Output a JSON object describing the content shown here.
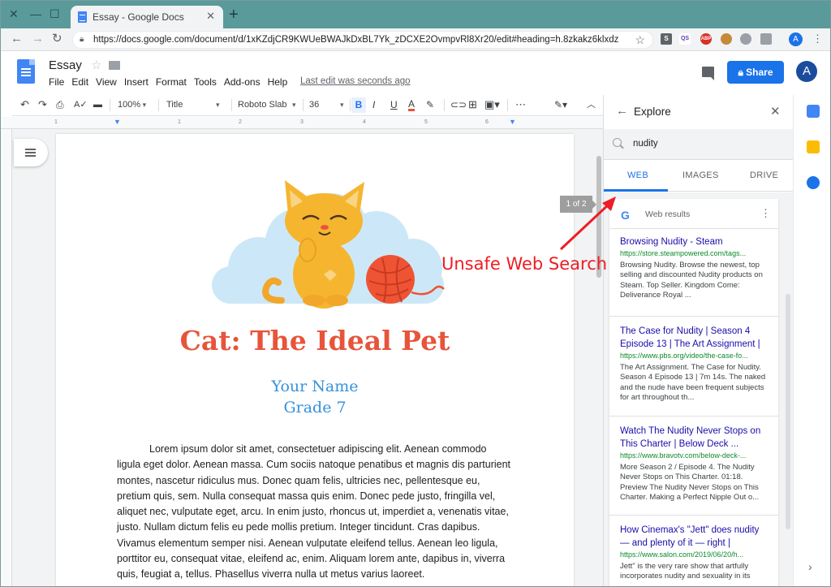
{
  "browser": {
    "tab_title": "Essay - Google Docs",
    "url": "https://docs.google.com/document/d/1xKZdjCR9KWUeBWAJkDxBL7Yk_zDCXE2OvmpvRl8Xr20/edit#heading=h.8zkakz6klxdz",
    "profile_initial": "A",
    "extensions": [
      "S",
      "QS",
      "ABP"
    ]
  },
  "docs": {
    "title": "Essay",
    "menu": [
      "File",
      "Edit",
      "View",
      "Insert",
      "Format",
      "Tools",
      "Add-ons",
      "Help"
    ],
    "last_edit": "Last edit was seconds ago",
    "share_label": "Share",
    "avatar_initial": "A"
  },
  "toolbar": {
    "zoom": "100%",
    "style": "Title",
    "font": "Roboto Slab",
    "size": "36",
    "bold": "B",
    "italic": "I",
    "underline": "U",
    "text_color": "A"
  },
  "ruler": [
    "1",
    "1",
    "2",
    "3",
    "4",
    "5",
    "6"
  ],
  "page": {
    "title": "Cat: The Ideal Pet",
    "name": "Your Name",
    "grade": "Grade 7",
    "body_lines": [
      "Lorem ipsum dolor sit amet, consectetuer adipiscing elit. Aenean commodo",
      "ligula eget dolor. Aenean massa. Cum sociis natoque penatibus et magnis dis parturient",
      "montes, nascetur ridiculus mus. Donec quam felis, ultricies nec, pellentesque eu,",
      "pretium quis, sem. Nulla consequat massa quis enim. Donec pede justo, fringilla vel,",
      "aliquet nec, vulputate eget, arcu. In enim justo, rhoncus ut, imperdiet a, venenatis vitae,",
      "justo. Nullam dictum felis eu pede mollis pretium. Integer tincidunt. Cras dapibus.",
      "Vivamus elementum semper nisi. Aenean vulputate eleifend tellus. Aenean leo ligula,",
      "porttitor eu, consequat vitae, eleifend ac, enim. Aliquam lorem ante, dapibus in, viverra",
      "quis, feugiat a, tellus. Phasellus viverra nulla ut metus varius laoreet."
    ]
  },
  "explore": {
    "title": "Explore",
    "query": "nudity",
    "tabs": [
      "WEB",
      "IMAGES",
      "DRIVE"
    ],
    "results_label": "Web results",
    "results": [
      {
        "title": "Browsing Nudity - Steam",
        "url": "https://store.steampowered.com/tags...",
        "snippet": "Browsing Nudity. Browse the newest, top selling and discounted Nudity products on Steam. Top Seller. Kingdom Come: Deliverance Royal ..."
      },
      {
        "title": "The Case for Nudity | Season 4 Episode 13 | The Art Assignment |",
        "url": "https://www.pbs.org/video/the-case-fo...",
        "snippet": "The Art Assignment. The Case for Nudity. Season 4 Episode 13 | 7m 14s. The naked and the nude have been frequent subjects for art throughout th..."
      },
      {
        "title": "Watch The Nudity Never Stops on This Charter | Below Deck ...",
        "url": "https://www.bravotv.com/below-deck-...",
        "snippet": "More Season 2 / Episode 4. The Nudity Never Stops on This Charter. 01:18. Preview The Nudity Never Stops on This Charter. Making a Perfect Nipple Out o..."
      },
      {
        "title": "How Cinemax's \"Jett\" does nudity — and plenty of it — right |",
        "url": "https://www.salon.com/2019/06/20/h...",
        "snippet": "Jett\" is the very rare show that artfully incorporates nudity and sexuality in its"
      }
    ]
  },
  "annotation": {
    "page_indicator": "1 of 2",
    "label": "Unsafe Web Search",
    "color": "#ee1c24"
  }
}
